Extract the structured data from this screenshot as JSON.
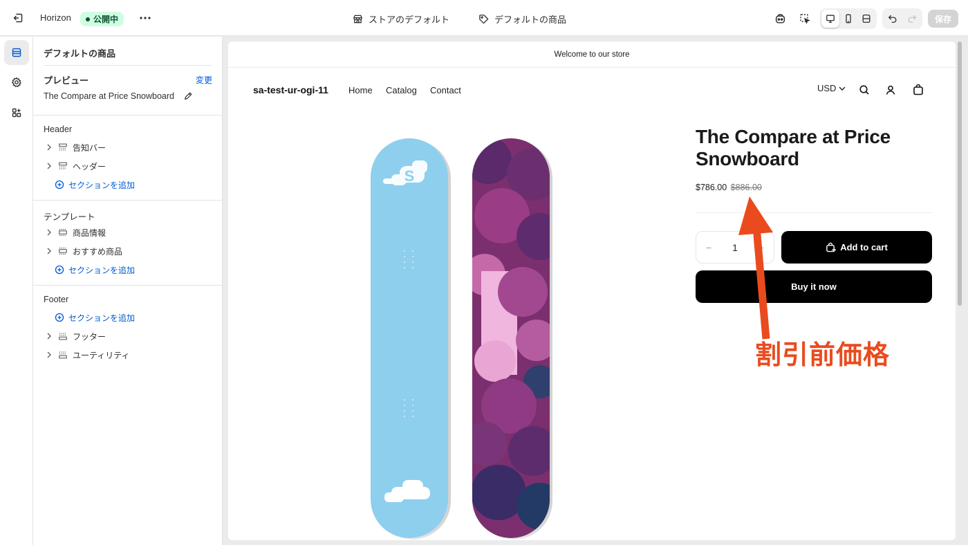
{
  "topbar": {
    "theme_name": "Horizon",
    "status_badge": "公開中",
    "store_template": "ストアのデフォルト",
    "product_template": "デフォルトの商品",
    "save_label": "保存"
  },
  "panel": {
    "title": "デフォルトの商品",
    "preview_label": "プレビュー",
    "change_link": "変更",
    "preview_product": "The Compare at Price Snowboard",
    "groups": [
      {
        "heading": "Header",
        "items": [
          "告知バー",
          "ヘッダー"
        ],
        "add_label": "セクションを追加"
      },
      {
        "heading": "テンプレート",
        "items": [
          "商品情報",
          "おすすめ商品"
        ],
        "add_label": "セクションを追加"
      },
      {
        "heading": "Footer",
        "add_label": "セクションを追加",
        "items": [
          "フッター",
          "ユーティリティ"
        ]
      }
    ]
  },
  "preview": {
    "announcement": "Welcome to our store",
    "store_name": "sa-test-ur-ogi-11",
    "nav": [
      "Home",
      "Catalog",
      "Contact"
    ],
    "currency": "USD",
    "product_title": "The Compare at Price Snowboard",
    "price": "$786.00",
    "compare_price": "$886.00",
    "quantity": "1",
    "add_to_cart": "Add to cart",
    "buy_now": "Buy it now"
  },
  "annotation": {
    "label": "割引前価格",
    "color": "#ea4b1e"
  },
  "colors": {
    "accent": "#005bd3",
    "badge_bg": "#cdfee1",
    "badge_text": "#0c5132",
    "board_left": "#8ecfee",
    "board_right": "#7b2f6e"
  }
}
